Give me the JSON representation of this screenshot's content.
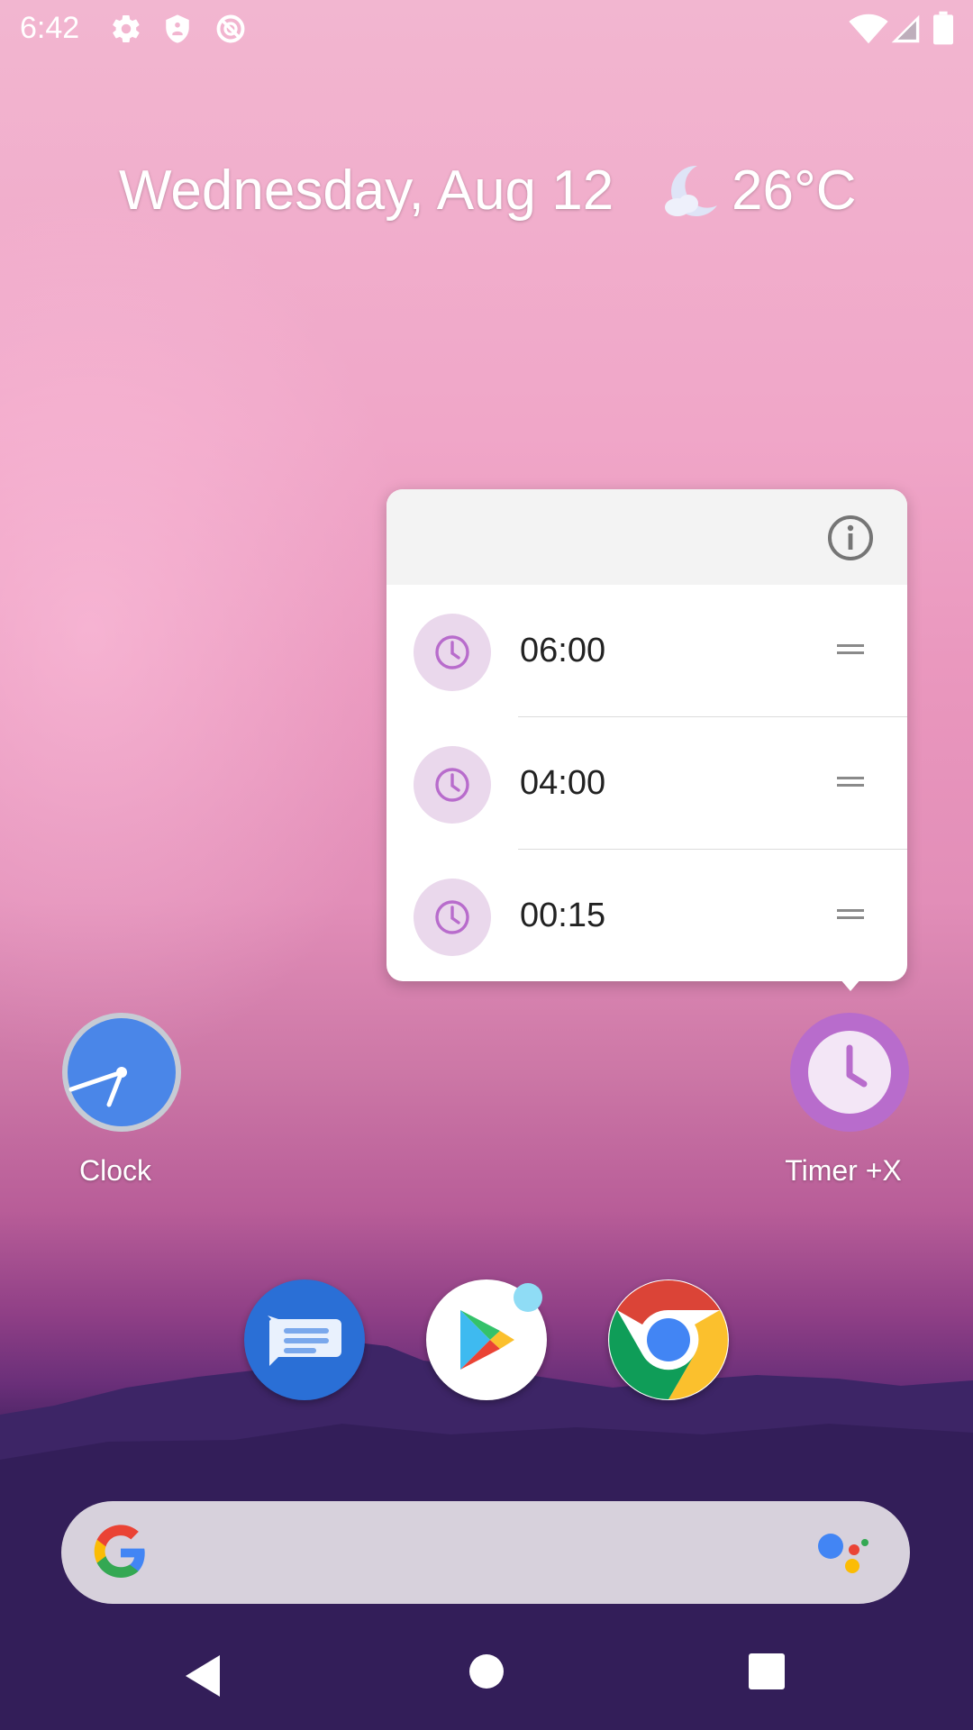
{
  "status_bar": {
    "time": "6:42",
    "left_icons": [
      "settings-icon",
      "shield-icon",
      "data-saver-icon"
    ],
    "right_icons": [
      "wifi-icon",
      "signal-icon",
      "battery-icon"
    ]
  },
  "widget": {
    "date": "Wednesday, Aug 12",
    "weather_icon": "moon-cloud-icon",
    "temperature": "26°C"
  },
  "popup": {
    "header_icon": "info-icon",
    "shortcuts": [
      {
        "label": "06:00",
        "icon": "clock-icon"
      },
      {
        "label": "04:00",
        "icon": "clock-icon"
      },
      {
        "label": "00:15",
        "icon": "clock-icon"
      }
    ]
  },
  "apps": {
    "clock": {
      "label": "Clock"
    },
    "timer": {
      "label": "Timer +X"
    }
  },
  "dock": [
    {
      "name": "messages",
      "icon": "messages-icon"
    },
    {
      "name": "play-store",
      "icon": "play-store-icon",
      "notification_dot": true
    },
    {
      "name": "chrome",
      "icon": "chrome-icon"
    }
  ],
  "search": {
    "logo": "google-icon",
    "assistant": "assistant-icon"
  },
  "nav": [
    "back-icon",
    "home-icon",
    "recents-icon"
  ],
  "colors": {
    "accent_purple": "#b86ccc",
    "clock_blue": "#4a86e8",
    "popup_icon_bg": "#ead8ec",
    "notification_dot": "#8fdcf5"
  }
}
